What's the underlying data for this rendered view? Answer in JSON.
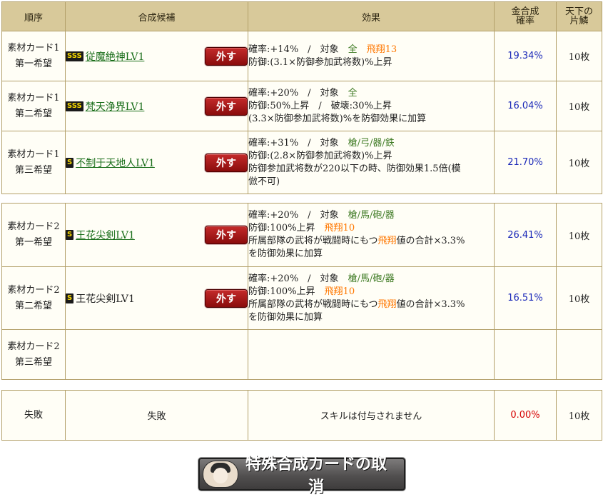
{
  "header": {
    "order": "順序",
    "candidate": "合成候補",
    "effect": "効果",
    "rate_l1": "金合成",
    "rate_l2": "確率",
    "scale_l1": "天下の",
    "scale_l2": "片鱗"
  },
  "remove_label": "外す",
  "card1": {
    "rows": [
      {
        "order_l1": "素材カード1",
        "order_l2": "第一希望",
        "rank": "SSS",
        "skill": "従魔絶神LV1",
        "effect": {
          "l1_pre": "確率:+14%　/　対象　",
          "l1_target": "全",
          "l1_hisho": "　飛翔13",
          "l2": "防御:(3.1×防御参加武将数)%上昇"
        },
        "rate": "19.34%",
        "scale": "10枚"
      },
      {
        "order_l1": "素材カード1",
        "order_l2": "第二希望",
        "rank": "SSS",
        "skill": "梵天浄界LV1",
        "effect": {
          "l1_pre": "確率:+20%　/　対象　",
          "l1_target": "全",
          "l2": "防御:50%上昇　/　破壊:30%上昇",
          "l3": "(3.3×防御参加武将数)%を防御効果に加算"
        },
        "rate": "16.04%",
        "scale": "10枚"
      },
      {
        "order_l1": "素材カード1",
        "order_l2": "第三希望",
        "rank": "S",
        "skill": "不制于天地人LV1",
        "effect": {
          "l1_pre": "確率:+31%　/　対象　",
          "l1_target": "槍/弓/器/鉄",
          "l2": "防御:(2.8×防御参加武将数)%上昇",
          "l3": "防御参加武将数が220以下の時、防御効果1.5倍(模",
          "l4": "倣不可)"
        },
        "rate": "21.70%",
        "scale": "10枚"
      }
    ]
  },
  "card2": {
    "rows": [
      {
        "order_l1": "素材カード2",
        "order_l2": "第一希望",
        "rank": "S",
        "skill": "王花尖剣LV1",
        "effect": {
          "l1_pre": "確率:+20%　/　対象　",
          "l1_target": "槍/馬/砲/器",
          "l2_pre": "防御:100%上昇　",
          "l2_hisho": "飛翔10",
          "l3_pre": "所属部隊の武将が戦闘時にもつ",
          "l3_hisho": "飛翔",
          "l3_post": "値の合計×3.3%",
          "l4": "を防御効果に加算"
        },
        "rate": "26.41%",
        "scale": "10枚"
      },
      {
        "order_l1": "素材カード2",
        "order_l2": "第二希望",
        "rank": "S",
        "skill": "王花尖剣LV1",
        "effect": {
          "l1_pre": "確率:+20%　/　対象　",
          "l1_target": "槍/馬/砲/器",
          "l2_pre": "防御:100%上昇　",
          "l2_hisho": "飛翔10",
          "l3_pre": "所属部隊の武将が戦闘時にもつ",
          "l3_hisho": "飛翔",
          "l3_post": "値の合計×3.3%",
          "l4": "を防御効果に加算"
        },
        "rate": "16.51%",
        "scale": "10枚"
      },
      {
        "order_l1": "素材カード2",
        "order_l2": "第三希望"
      }
    ]
  },
  "failure": {
    "order": "失敗",
    "candidate": "失敗",
    "effect": "スキルは付与されません",
    "rate": "0.00%",
    "scale": "10枚"
  },
  "cancel_button": "特殊合成カードの取消",
  "colors": {
    "header_bg": "#d8c99a",
    "border": "#b3a06a",
    "skill_link": "#1a6e1a",
    "target_text": "#3e7a23",
    "hisho_text": "#ff7700",
    "rate_blue": "#1a28b8",
    "rate_red": "#d60000",
    "remove_button": "#a81818"
  }
}
